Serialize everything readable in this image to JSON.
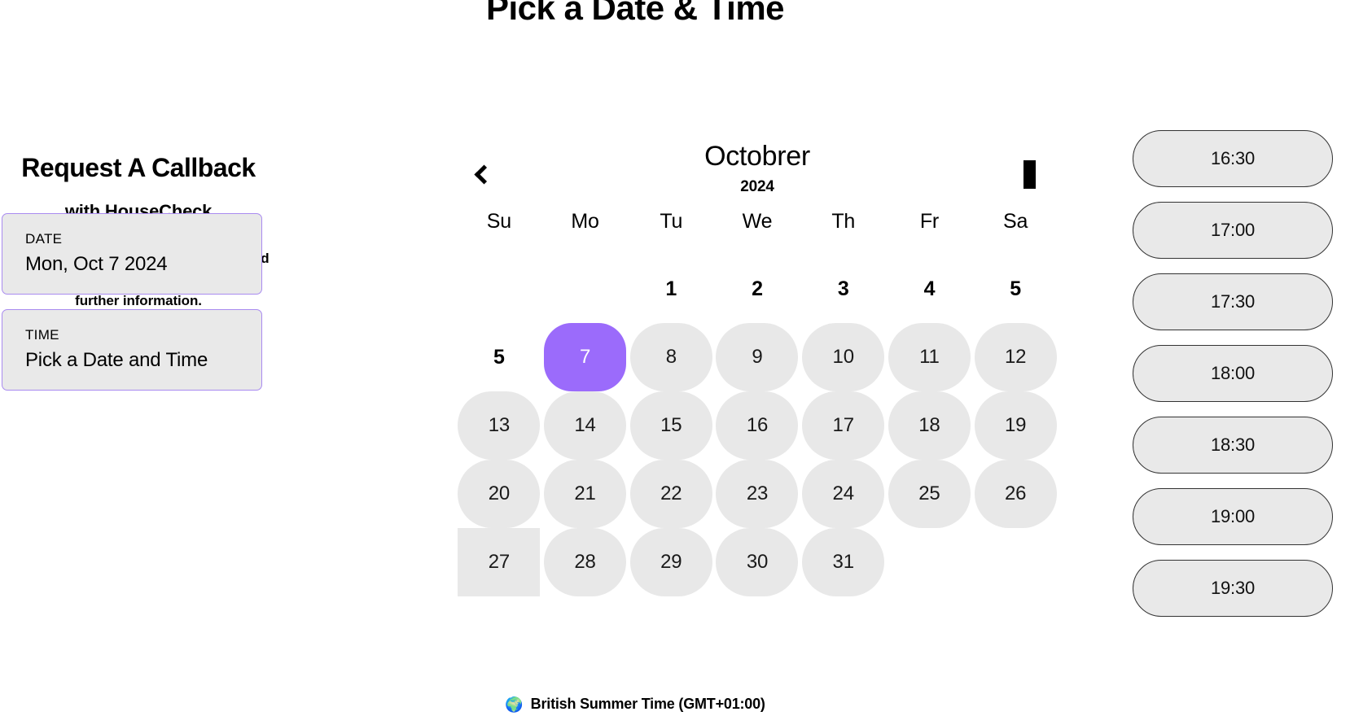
{
  "page": {
    "title": "Pick a Date & Time"
  },
  "left_panel": {
    "brand_title": "Request A Callback",
    "brand_subtitle": "with HouseCheck",
    "description": "Receive a call from one of our UK based ECO grants specialists if you require further information.",
    "date_field": {
      "label": "DATE",
      "value": "Mon, Oct 7 2024"
    },
    "time_field": {
      "label": "TIME",
      "value": "Pick a Date and Time"
    }
  },
  "calendar": {
    "month": "Octobrer",
    "year": "2024",
    "prev_icon": "chevron-left-icon",
    "next_icon": "missing-glyph-box-icon",
    "day_headers": [
      "Su",
      "Mo",
      "Tu",
      "We",
      "Th",
      "Fr",
      "Sa"
    ],
    "selected_day": "7",
    "weeks": [
      [
        {
          "label": "",
          "style": "empty"
        },
        {
          "label": "",
          "style": "empty"
        },
        {
          "label": "1",
          "style": "plain"
        },
        {
          "label": "2",
          "style": "plain"
        },
        {
          "label": "3",
          "style": "plain"
        },
        {
          "label": "4",
          "style": "plain"
        },
        {
          "label": "5",
          "style": "plain"
        }
      ],
      [
        {
          "label": "5",
          "style": "plain"
        },
        {
          "label": "7",
          "style": "selected"
        },
        {
          "label": "8",
          "style": "pill"
        },
        {
          "label": "9",
          "style": "pill"
        },
        {
          "label": "10",
          "style": "pill"
        },
        {
          "label": "11",
          "style": "pill"
        },
        {
          "label": "12",
          "style": "pill"
        }
      ],
      [
        {
          "label": "13",
          "style": "pill"
        },
        {
          "label": "14",
          "style": "pill"
        },
        {
          "label": "15",
          "style": "pill"
        },
        {
          "label": "16",
          "style": "pill"
        },
        {
          "label": "17",
          "style": "pill"
        },
        {
          "label": "18",
          "style": "pill"
        },
        {
          "label": "19",
          "style": "pill"
        }
      ],
      [
        {
          "label": "20",
          "style": "pill"
        },
        {
          "label": "21",
          "style": "pill"
        },
        {
          "label": "22",
          "style": "pill"
        },
        {
          "label": "23",
          "style": "pill"
        },
        {
          "label": "24",
          "style": "pill"
        },
        {
          "label": "25",
          "style": "pill"
        },
        {
          "label": "26",
          "style": "pill"
        }
      ],
      [
        {
          "label": "27",
          "style": "square"
        },
        {
          "label": "28",
          "style": "pill"
        },
        {
          "label": "29",
          "style": "pill"
        },
        {
          "label": "30",
          "style": "pill"
        },
        {
          "label": "31",
          "style": "pill"
        },
        {
          "label": "",
          "style": "empty"
        },
        {
          "label": "",
          "style": "empty"
        }
      ]
    ]
  },
  "time_slots": [
    "16:30",
    "17:00",
    "17:30",
    "18:00",
    "18:30",
    "19:00",
    "19:30"
  ],
  "timezone": {
    "icon": "globe-icon",
    "glyph": "🌍",
    "label": "British Summer Time (GMT+01:00)"
  },
  "colors": {
    "accent_purple": "#9b6bfb",
    "pill_grey": "#e8e8e8",
    "field_border_purple": "#a98bf0",
    "text_black": "#000000"
  }
}
